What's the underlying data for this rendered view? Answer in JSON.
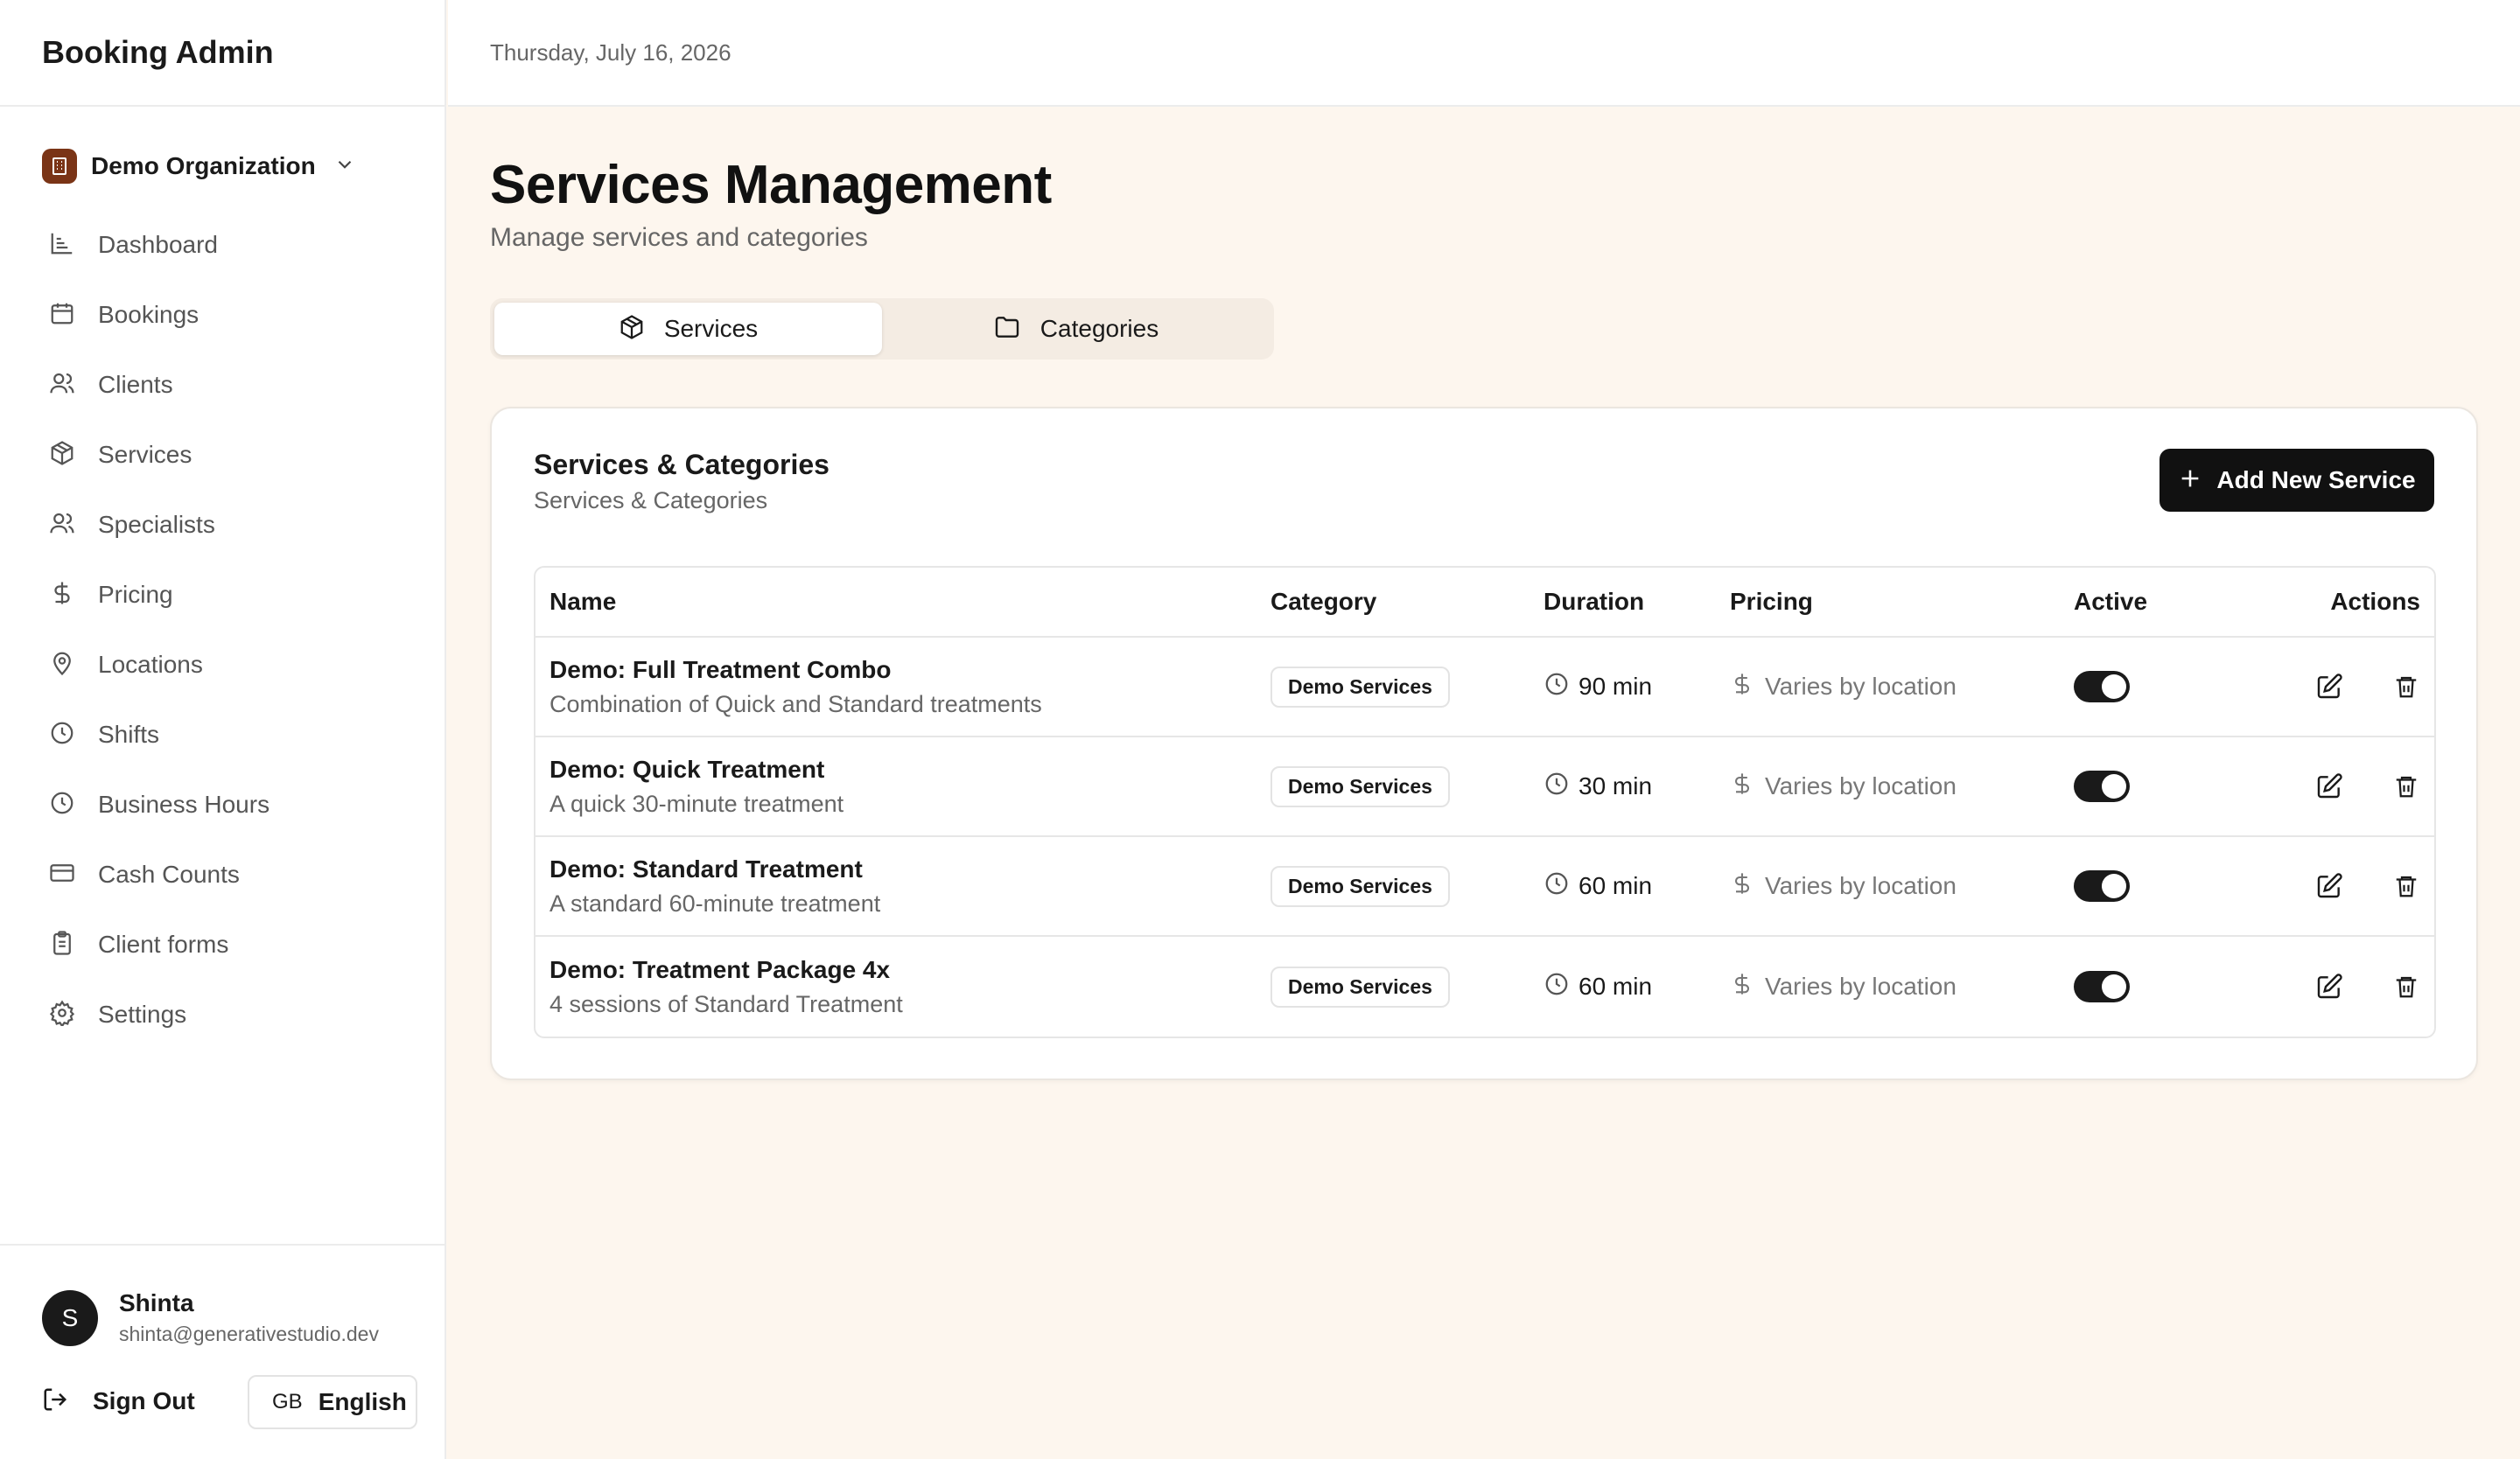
{
  "app": {
    "title": "Booking Admin"
  },
  "org": {
    "name": "Demo Organization"
  },
  "nav": {
    "items": [
      {
        "label": "Dashboard",
        "icon": "chart-icon"
      },
      {
        "label": "Bookings",
        "icon": "calendar-icon"
      },
      {
        "label": "Clients",
        "icon": "users-icon"
      },
      {
        "label": "Services",
        "icon": "package-icon"
      },
      {
        "label": "Specialists",
        "icon": "users-icon"
      },
      {
        "label": "Pricing",
        "icon": "dollar-icon"
      },
      {
        "label": "Locations",
        "icon": "map-pin-icon"
      },
      {
        "label": "Shifts",
        "icon": "clock-icon"
      },
      {
        "label": "Business Hours",
        "icon": "clock-icon"
      },
      {
        "label": "Cash Counts",
        "icon": "credit-card-icon"
      },
      {
        "label": "Client forms",
        "icon": "clipboard-icon"
      },
      {
        "label": "Settings",
        "icon": "gear-icon"
      }
    ]
  },
  "user": {
    "initial": "S",
    "name": "Shinta",
    "email": "shinta@generativestudio.dev"
  },
  "footer": {
    "signout_label": "Sign Out",
    "lang_code": "GB",
    "lang_label": "English"
  },
  "topbar": {
    "date": "Thursday, July 16, 2026"
  },
  "page": {
    "title": "Services Management",
    "subtitle": "Manage services and categories"
  },
  "tabs": [
    {
      "label": "Services",
      "active": true,
      "icon": "package-icon"
    },
    {
      "label": "Categories",
      "active": false,
      "icon": "folder-icon"
    }
  ],
  "card": {
    "title": "Services & Categories",
    "subtitle": "Services & Categories",
    "add_label": "Add New Service"
  },
  "table": {
    "headers": {
      "name": "Name",
      "category": "Category",
      "duration": "Duration",
      "pricing": "Pricing",
      "active": "Active",
      "actions": "Actions"
    },
    "rows": [
      {
        "name": "Demo: Full Treatment Combo",
        "desc": "Combination of Quick and Standard treatments",
        "category": "Demo Services",
        "duration": "90 min",
        "pricing": "Varies by location",
        "active": true
      },
      {
        "name": "Demo: Quick Treatment",
        "desc": "A quick 30-minute treatment",
        "category": "Demo Services",
        "duration": "30 min",
        "pricing": "Varies by location",
        "active": true
      },
      {
        "name": "Demo: Standard Treatment",
        "desc": "A standard 60-minute treatment",
        "category": "Demo Services",
        "duration": "60 min",
        "pricing": "Varies by location",
        "active": true
      },
      {
        "name": "Demo: Treatment Package 4x",
        "desc": "4 sessions of Standard Treatment",
        "category": "Demo Services",
        "duration": "60 min",
        "pricing": "Varies by location",
        "active": true
      }
    ]
  },
  "colors": {
    "page_bg": "#fdf6ee",
    "accent": "#111111",
    "org_logo": "#7a3416"
  }
}
